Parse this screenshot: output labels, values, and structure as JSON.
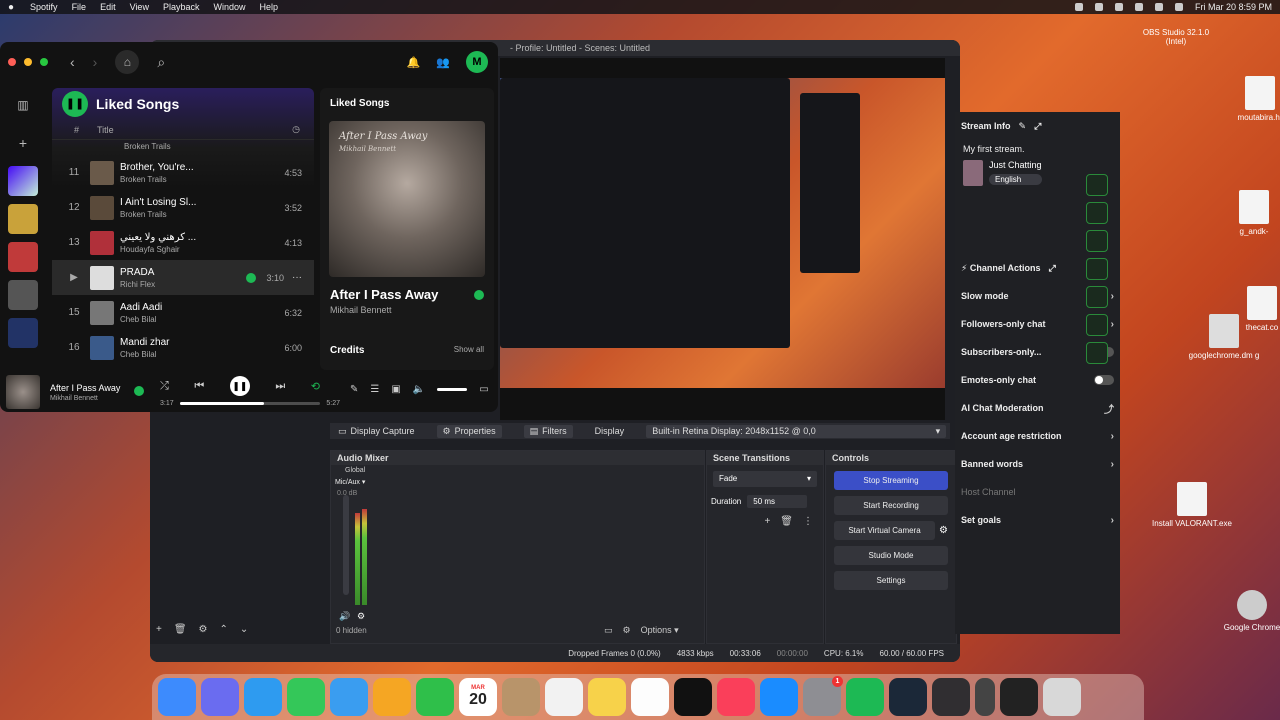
{
  "menubar": {
    "app": "Spotify",
    "items": [
      "File",
      "Edit",
      "View",
      "Playback",
      "Window",
      "Help"
    ],
    "datetime": "Fri Mar 20  8:59 PM"
  },
  "desktop": {
    "obs_label": "OBS Studio 32.1.0 (Intel)",
    "icons": [
      "moutabira.hr",
      "g_andk-",
      "thecat.co",
      "googlechrome.dm g",
      "Install VALORANT.exe",
      "Google Chrome"
    ]
  },
  "obs": {
    "title": "- Profile: Untitled - Scenes: Untitled",
    "context": {
      "source": "Display Capture",
      "properties": "Properties",
      "filters": "Filters",
      "display_label": "Display",
      "display_value": "Built-in Retina Display: 2048x1152 @ 0,0"
    },
    "mixer": {
      "title": "Audio Mixer",
      "tab": "Global",
      "channel": "Mic/Aux",
      "db": "0.0 dB",
      "hidden": "0 hidden",
      "options": "Options"
    },
    "transitions": {
      "title": "Scene Transitions",
      "type": "Fade",
      "duration_label": "Duration",
      "duration_value": "50 ms"
    },
    "controls": {
      "title": "Controls",
      "buttons": [
        "Stop Streaming",
        "Start Recording",
        "Start Virtual Camera",
        "Studio Mode",
        "Settings"
      ]
    },
    "status": {
      "dropped": "Dropped Frames 0 (0.0%)",
      "bitrate": "4833 kbps",
      "stream_time": "00:33:06",
      "rec_time": "00:00:00",
      "cpu": "CPU: 6.1%",
      "fps": "60.00 / 60.00 FPS"
    }
  },
  "stream_panel": {
    "header": "Stream Info",
    "stream_title": "My first stream.",
    "category": "Just Chatting",
    "language": "English",
    "actions_header": "Channel Actions",
    "actions": [
      {
        "label": "Slow mode",
        "type": "chevron"
      },
      {
        "label": "Followers-only chat",
        "type": "chevron"
      },
      {
        "label": "Subscribers-only...",
        "type": "toggle"
      },
      {
        "label": "Emotes-only chat",
        "type": "toggle"
      },
      {
        "label": "AI Chat Moderation",
        "type": "external"
      },
      {
        "label": "Account age restriction",
        "type": "chevron"
      },
      {
        "label": "Banned words",
        "type": "chevron"
      },
      {
        "label": "Host Channel",
        "type": "none"
      },
      {
        "label": "Set goals",
        "type": "chevron"
      }
    ]
  },
  "spotify": {
    "avatar": "M",
    "playlist": "Liked Songs",
    "col_num": "#",
    "col_title": "Title",
    "partial_artist": "Broken Trails",
    "tracks": [
      {
        "num": "11",
        "name": "Brother, You're...",
        "artist": "Broken Trails",
        "dur": "4:53",
        "color": "#6a5a4a"
      },
      {
        "num": "12",
        "name": "I Ain't Losing Sl...",
        "artist": "Broken Trails",
        "dur": "3:52",
        "color": "#5a4a3a"
      },
      {
        "num": "13",
        "name": "كرهني ولا يعيني ...",
        "artist": "Houdayfa Sghair",
        "dur": "4:13",
        "color": "#b0303a"
      },
      {
        "num": "",
        "name": "PRADA",
        "artist": "Richi Flex",
        "dur": "3:10",
        "color": "#ddd"
      },
      {
        "num": "15",
        "name": "Aadi Aadi",
        "artist": "Cheb Bilal",
        "dur": "6:32",
        "color": "#777"
      },
      {
        "num": "16",
        "name": "Mandi zhar",
        "artist": "Cheb Bilal",
        "dur": "6:00",
        "color": "#3a5a8a"
      }
    ],
    "panel": {
      "title": "Liked Songs",
      "art_line1": "After I Pass Away",
      "art_line2": "Mikhail Bennett",
      "song": "After I Pass Away",
      "artist": "Mikhail Bennett",
      "credits": "Credits",
      "show_all": "Show all"
    },
    "player": {
      "song": "After I Pass Away",
      "artist": "Mikhail Bennett",
      "elapsed": "3:17",
      "total": "5:27",
      "progress": 0.6
    }
  },
  "dock": {
    "calendar_month": "MAR",
    "calendar_day": "20",
    "settings_badge": "1"
  }
}
